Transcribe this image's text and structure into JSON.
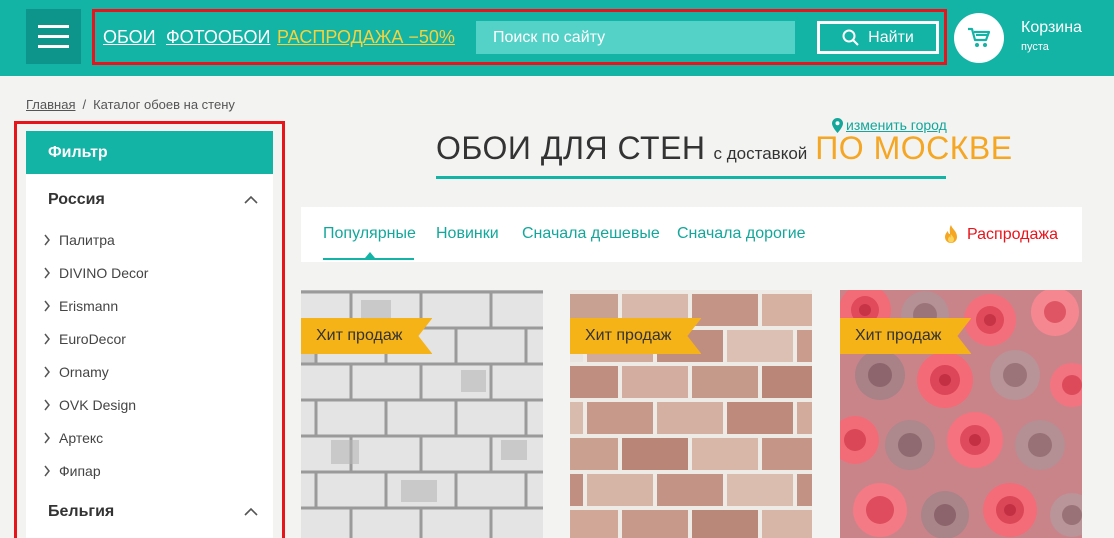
{
  "header": {
    "nav": {
      "oboi": "ОБОИ",
      "fotooboi": "ФОТООБОИ",
      "sale": "РАСПРОДАЖА −50%"
    },
    "search": {
      "placeholder": "Поиск по сайту",
      "button_label": "Найти"
    },
    "cart": {
      "title": "Корзина",
      "status": "пуста"
    },
    "colors": {
      "brand": "#13b3a6",
      "sale": "#f4d33e",
      "highlight": "#e8141b"
    }
  },
  "breadcrumb": {
    "home": "Главная",
    "separator": "/",
    "current": "Каталог обоев на стену"
  },
  "sidebar": {
    "filter_label": "Фильтр",
    "groups": [
      {
        "title": "Россия",
        "brands": [
          "Палитра",
          "DIVINO Decor",
          "Erismann",
          "EuroDecor",
          "Ornamy",
          "OVK Design",
          "Артекс",
          "Фипар"
        ]
      },
      {
        "title": "Бельгия",
        "brands": []
      }
    ]
  },
  "main": {
    "change_city": "изменить город",
    "title": {
      "part1": "ОБОИ ДЛЯ СТЕН",
      "part2": "с доставкой",
      "part3": "ПО МОСКВЕ"
    },
    "sort_tabs": [
      "Популярные",
      "Новинки",
      "Сначала дешевые",
      "Сначала дорогие"
    ],
    "active_sort": "Популярные",
    "sale_link": "Распродажа",
    "products": [
      {
        "badge": "Хит продаж",
        "image": "white-brick-wallpaper"
      },
      {
        "badge": "Хит продаж",
        "image": "beige-brick-wallpaper"
      },
      {
        "badge": "Хит продаж",
        "image": "pink-roses-wallpaper"
      }
    ]
  }
}
